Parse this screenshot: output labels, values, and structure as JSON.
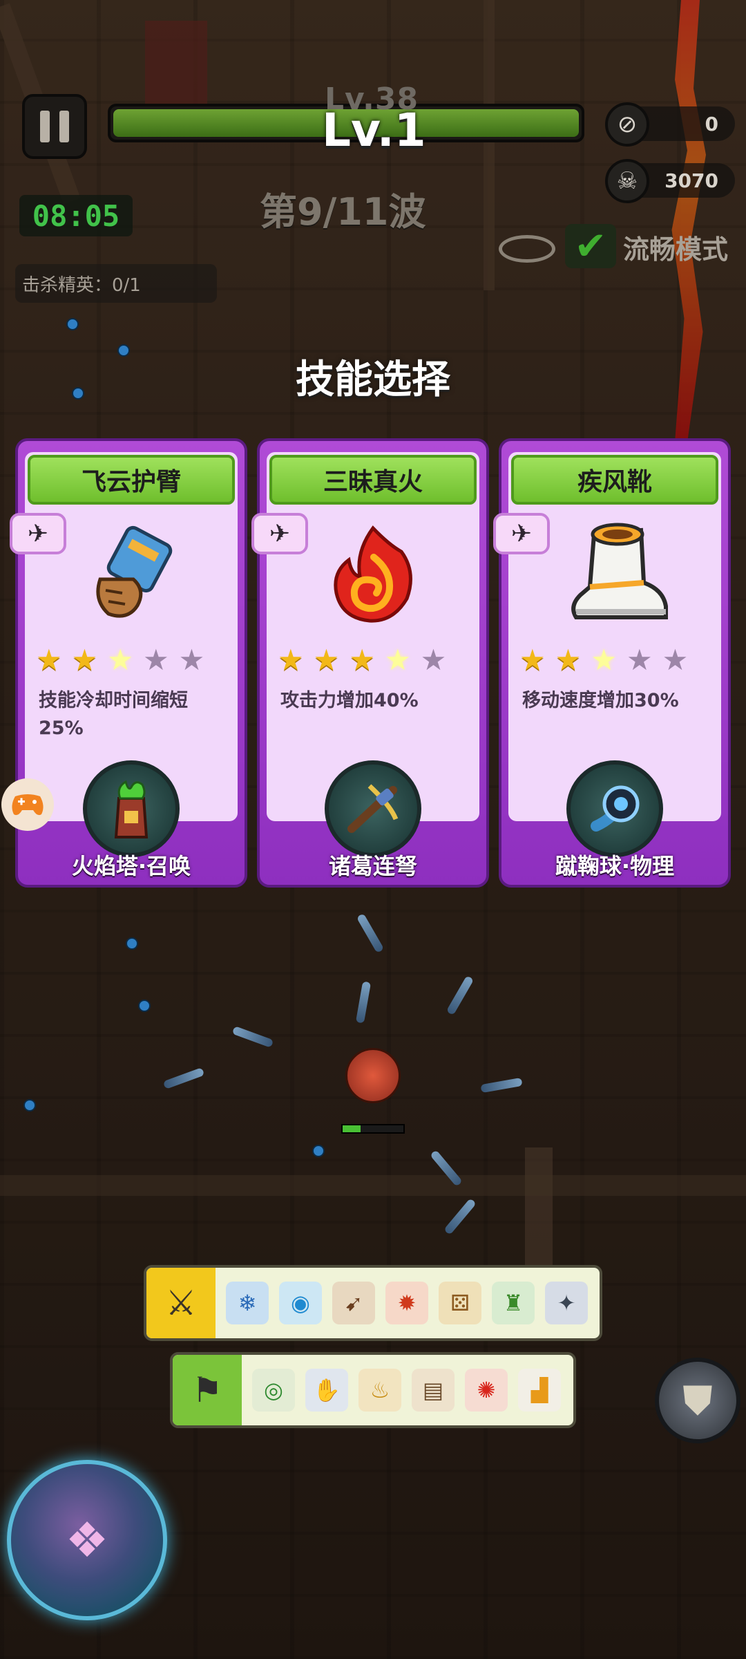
{
  "hud": {
    "level_ghost": "Lv.38",
    "level": "Lv.1",
    "xp_progress": 1.0,
    "coins": "0",
    "kills": "3070",
    "timer": "08:05",
    "wave": "第9/11波",
    "elite_kills": "击杀精英：0/1",
    "smooth_mode_label": "流畅模式",
    "smooth_mode_checked": true
  },
  "title": "技能选择",
  "cards": [
    {
      "name": "飞云护臂",
      "stars_filled": 2,
      "stars_total": 5,
      "description": "技能冷却时间缩短25%",
      "combo": "火焰塔·召唤",
      "art_icon": "gauntlet-icon",
      "combo_icon": "fire-tower-icon"
    },
    {
      "name": "三昧真火",
      "stars_filled": 3,
      "stars_total": 5,
      "description": "攻击力增加40%",
      "combo": "诸葛连弩",
      "art_icon": "fire-icon",
      "combo_icon": "crossbow-icon"
    },
    {
      "name": "疾风靴",
      "stars_filled": 2,
      "stars_total": 5,
      "description": "移动速度增加30%",
      "combo": "蹴鞠球·物理",
      "art_icon": "boot-icon",
      "combo_icon": "ball-icon"
    }
  ],
  "colors": {
    "card_purple": "#a241cf",
    "card_inner": "#f2d8fb",
    "name_green": "#86d244",
    "timer_green": "#41c24a",
    "star_gold": "#f2b818"
  }
}
